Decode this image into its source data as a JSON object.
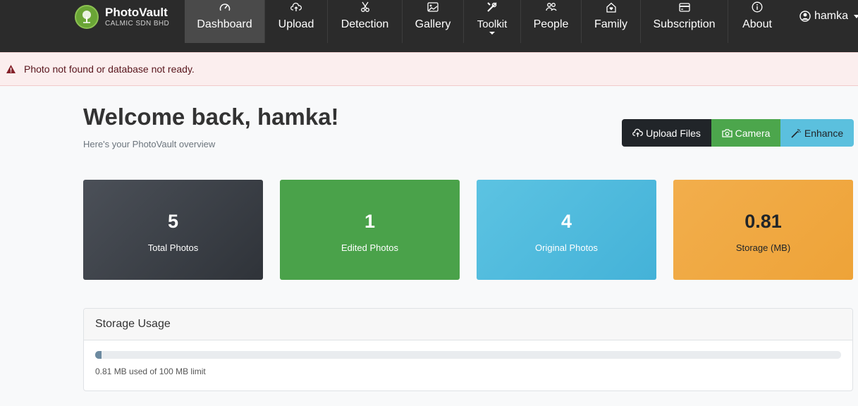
{
  "brand": {
    "name": "PhotoVault",
    "subtitle": "CALMIC SDN BHD"
  },
  "nav": [
    {
      "label": "Dashboard",
      "icon": "speedometer-icon",
      "active": true
    },
    {
      "label": "Upload",
      "icon": "cloud-upload-icon"
    },
    {
      "label": "Detection",
      "icon": "scissors-icon"
    },
    {
      "label": "Gallery",
      "icon": "image-icon"
    },
    {
      "label": "Toolkit",
      "icon": "tools-icon"
    },
    {
      "label": "People",
      "icon": "people-icon"
    },
    {
      "label": "Family",
      "icon": "house-heart-icon"
    },
    {
      "label": "Subscription",
      "icon": "credit-card-icon"
    },
    {
      "label": "About",
      "icon": "info-icon"
    }
  ],
  "user": {
    "name": "hamka"
  },
  "alert": {
    "text": "Photo not found or database not ready.",
    "color": "#842029"
  },
  "header": {
    "title": "Welcome back, hamka!",
    "subtitle": "Here's your PhotoVault overview"
  },
  "actions": {
    "upload": "Upload Files",
    "camera": "Camera",
    "enhance": "Enhance"
  },
  "stats": [
    {
      "value": "5",
      "label": "Total Photos",
      "color": "#3e4249"
    },
    {
      "value": "1",
      "label": "Edited Photos",
      "color": "#4aa24a"
    },
    {
      "value": "4",
      "label": "Original Photos",
      "color": "#52bbe0"
    },
    {
      "value": "0.81",
      "label": "Storage (MB)",
      "color": "#f0a841"
    }
  ],
  "storage": {
    "title": "Storage Usage",
    "used_fraction": 0.0081,
    "text": "0.81 MB used of 100 MB limit"
  }
}
